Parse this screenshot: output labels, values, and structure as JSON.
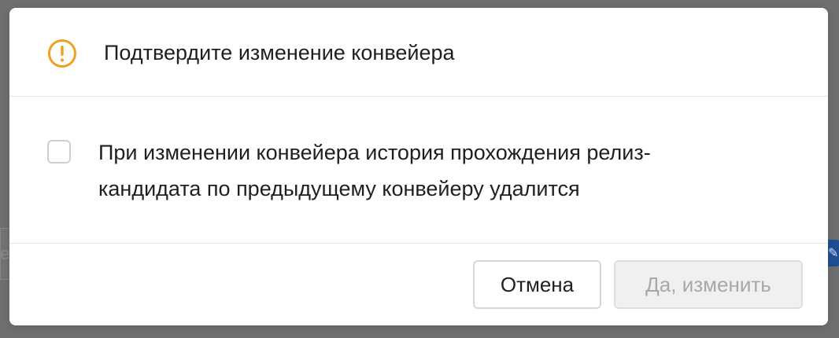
{
  "dialog": {
    "title": "Подтвердите изменение конвейера",
    "warning_icon": "exclamation-circle-icon",
    "accent_color": "#f0a020",
    "checkbox": {
      "checked": false,
      "label": "При изменении конвейера история прохождения релиз-кандидата по предыдущему конвейеру удалится"
    },
    "buttons": {
      "cancel_label": "Отмена",
      "confirm_label": "Да, изменить",
      "confirm_disabled": true
    }
  },
  "background": {
    "partial_text": "e",
    "partial_icon": "edit-icon"
  }
}
